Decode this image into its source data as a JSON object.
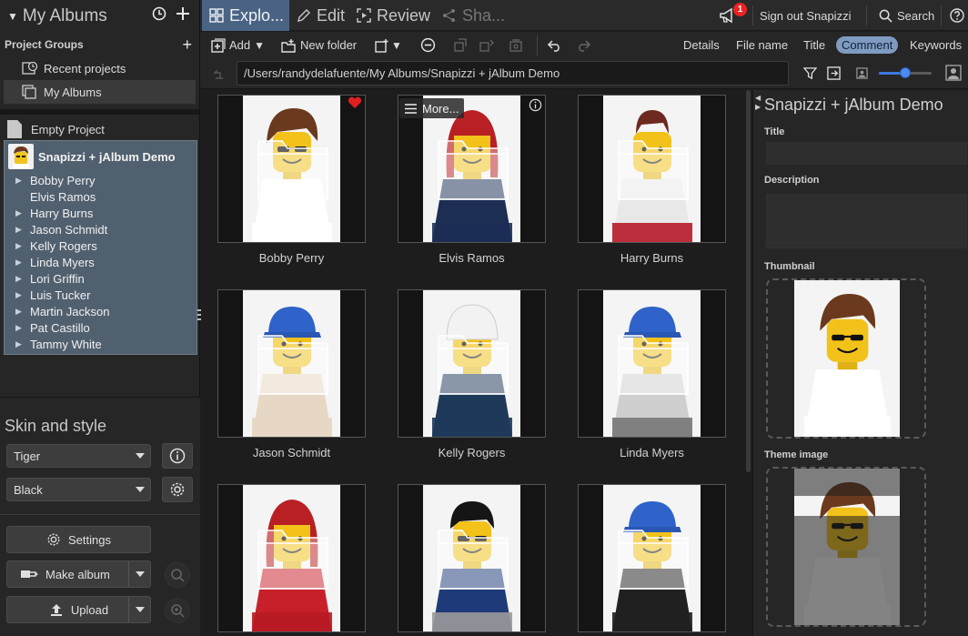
{
  "left": {
    "header_title": "My Albums",
    "groups_label": "Project Groups",
    "groups": [
      {
        "label": "Recent projects",
        "icon": "recent-projects-icon"
      },
      {
        "label": "My Albums",
        "icon": "albums-stack-icon",
        "selected": true
      }
    ],
    "empty_project": "Empty Project",
    "tree_root": "Snapizzi + jAlbum Demo",
    "tree_items": [
      {
        "label": "Bobby Perry",
        "expandable": true
      },
      {
        "label": "Elvis Ramos",
        "expandable": false
      },
      {
        "label": "Harry Burns",
        "expandable": true
      },
      {
        "label": "Jason Schmidt",
        "expandable": true
      },
      {
        "label": "Kelly Rogers",
        "expandable": true
      },
      {
        "label": "Linda Myers",
        "expandable": true
      },
      {
        "label": "Lori Griffin",
        "expandable": true
      },
      {
        "label": "Luis Tucker",
        "expandable": true
      },
      {
        "label": "Martin Jackson",
        "expandable": true
      },
      {
        "label": "Pat Castillo",
        "expandable": true
      },
      {
        "label": "Tammy White",
        "expandable": true
      }
    ],
    "skin_title": "Skin and style",
    "skin_value": "Tiger",
    "style_value": "Black",
    "settings_label": "Settings",
    "make_album_label": "Make album",
    "upload_label": "Upload"
  },
  "topbar": {
    "tabs": [
      {
        "label": "Explo...",
        "active": true
      },
      {
        "label": "Edit"
      },
      {
        "label": "Review"
      },
      {
        "label": "Sha...",
        "disabled": true
      }
    ],
    "notification_count": "1",
    "sign_out": "Sign out Snapizzi",
    "search": "Search"
  },
  "toolbar": {
    "add": "Add",
    "new_folder": "New folder",
    "view_options": [
      "Details",
      "File name",
      "Title",
      "Comment",
      "Keywords"
    ],
    "selected_view": "Comment"
  },
  "pathbar": {
    "path": "/Users/randydelafuente/My Albums/Snapizzi + jAlbum Demo",
    "thumb_size": 0.5
  },
  "grid": {
    "more_label": "More...",
    "items": [
      {
        "caption": "Bobby Perry",
        "hat": "hair-brown",
        "shirt": "#ffffff",
        "pants": "#ffffff",
        "glasses": true,
        "favorite": true
      },
      {
        "caption": "Elvis Ramos",
        "hat": "hair-red",
        "shirt": "#1d2e55",
        "pants": "#1d2e55",
        "glasses": false,
        "more": true
      },
      {
        "caption": "Harry Burns",
        "hat": "hair-brown-short",
        "shirt": "#e8e8e8",
        "pants": "#b8192a",
        "glasses": false
      },
      {
        "caption": "Jason Schmidt",
        "hat": "cap-blue",
        "shirt": "#e6d8c4",
        "pants": "#e6d8c4",
        "glasses": false
      },
      {
        "caption": "Kelly Rogers",
        "hat": "helmet-white",
        "shirt": "#1e3a5a",
        "pants": "#1e3a5a",
        "glasses": false
      },
      {
        "caption": "Linda Myers",
        "hat": "cap-blue",
        "shirt": "#cfcfcf",
        "pants": "#777777",
        "glasses": false
      },
      {
        "caption": "",
        "hat": "hair-red",
        "shirt": "#c8202a",
        "pants": "#b81a22",
        "glasses": false
      },
      {
        "caption": "",
        "hat": "hair-black",
        "shirt": "#1e3a78",
        "pants": "#9a9a9a",
        "glasses": true
      },
      {
        "caption": "",
        "hat": "cap-blue",
        "shirt": "#202020",
        "pants": "#202020",
        "glasses": false
      }
    ]
  },
  "right": {
    "title": "Snapizzi + jAlbum Demo",
    "title_label": "Title",
    "description_label": "Description",
    "thumbnail_label": "Thumbnail",
    "theme_image_label": "Theme image"
  },
  "colors": {
    "accent": "#4a6383",
    "selection_chip": "#7f9bc0",
    "tree_bg": "#51606f",
    "badge": "#e22222",
    "favorite": "#e02020"
  }
}
